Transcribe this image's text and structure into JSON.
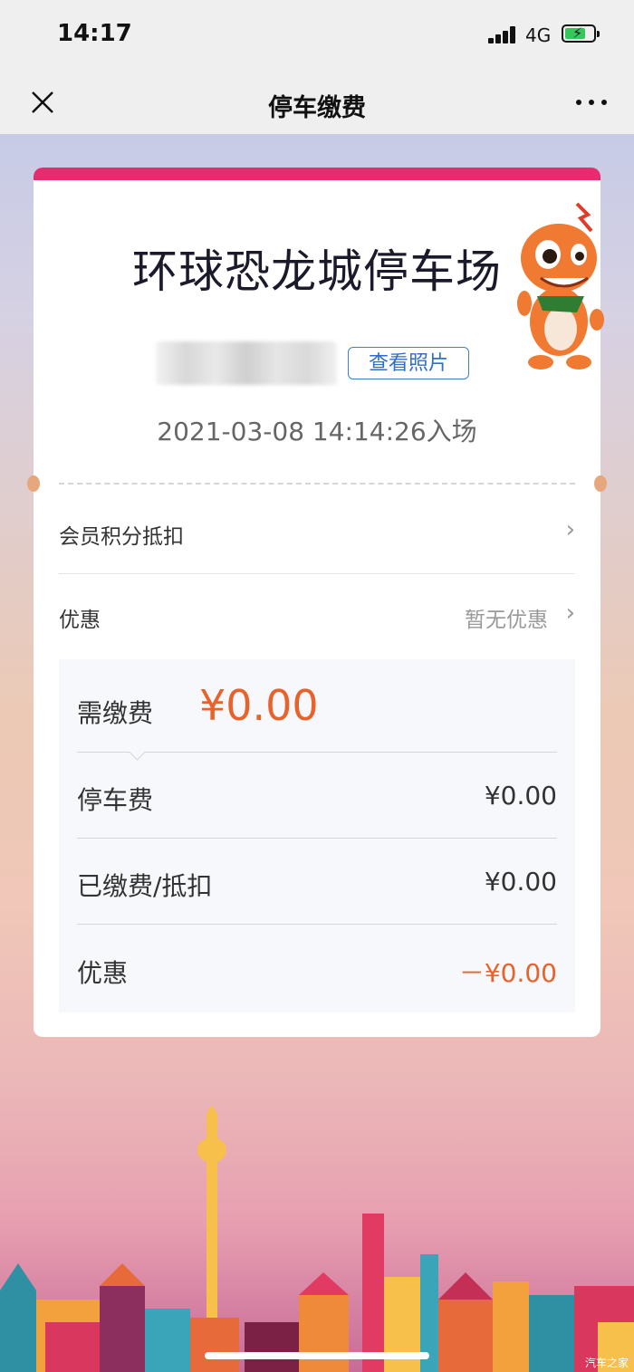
{
  "status_bar": {
    "time": "14:17",
    "network": "4G"
  },
  "nav": {
    "title": "停车缴费"
  },
  "card": {
    "lot_name": "环球恐龙城停车场",
    "view_photo_label": "查看照片",
    "entry_time": "2021-03-08 14:14:26入场",
    "points_label": "会员积分抵扣",
    "promo_label": "优惠",
    "promo_value": "暂无优惠"
  },
  "fees": {
    "due_label": "需缴费",
    "due_amount": "¥0.00",
    "rows": [
      {
        "label": "停车费",
        "value": "¥0.00"
      },
      {
        "label": "已缴费/抵扣",
        "value": "¥0.00"
      },
      {
        "label": "优惠",
        "value": "－¥0.00"
      }
    ]
  },
  "watermark": "汽车之家",
  "colors": {
    "accent_bar": "#e72b6f",
    "amount": "#e8622c",
    "link": "#2f6fc8"
  }
}
